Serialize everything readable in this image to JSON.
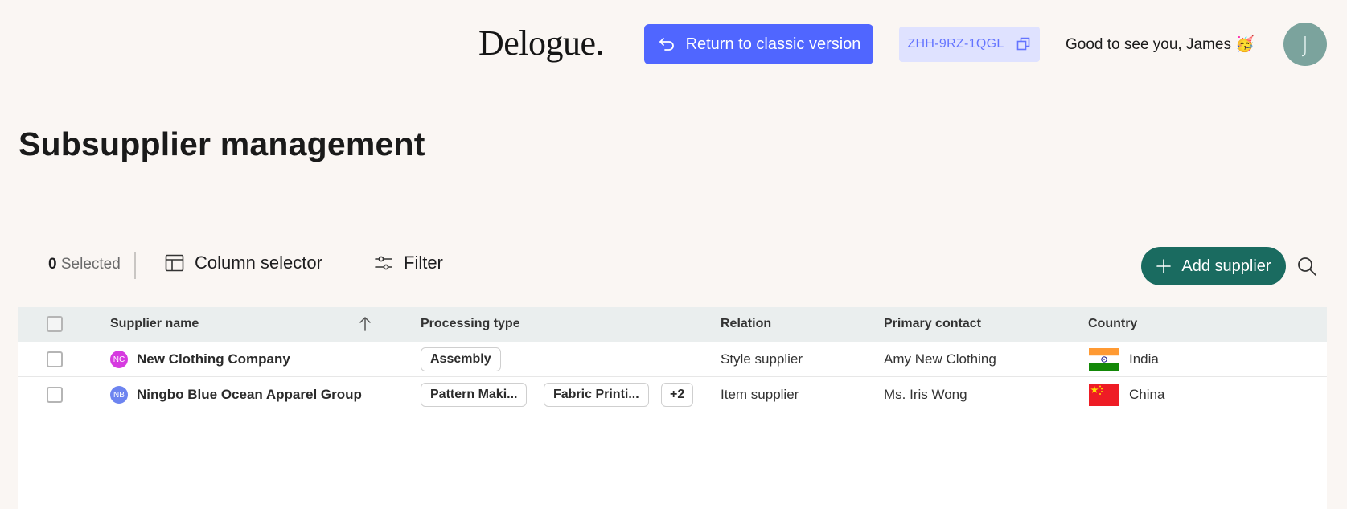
{
  "header": {
    "logo": "Delogue.",
    "classic_button": "Return to classic version",
    "code": "ZHH-9RZ-1QGL",
    "greeting": "Good to see you, James 🥳",
    "avatar_initial": "J"
  },
  "page": {
    "title": "Subsupplier management"
  },
  "toolbar": {
    "selected_count": "0",
    "selected_label": "Selected",
    "column_selector": "Column selector",
    "filter": "Filter",
    "add_supplier": "Add supplier"
  },
  "table": {
    "columns": [
      "Supplier name",
      "Processing type",
      "Relation",
      "Primary contact",
      "Country"
    ],
    "rows": [
      {
        "initials": "NC",
        "initials_color": "#d63be0",
        "name": "New Clothing Company",
        "tags": [
          "Assembly"
        ],
        "relation": "Style supplier",
        "contact": "Amy New Clothing",
        "country": "India"
      },
      {
        "initials": "NB",
        "initials_color": "#6d84f0",
        "name": "Ningbo Blue Ocean Apparel Group",
        "tags": [
          "Pattern Maki...",
          "Fabric Printi...",
          "+2"
        ],
        "relation": "Item supplier",
        "contact": "Ms. Iris Wong",
        "country": "China"
      }
    ]
  },
  "colors": {
    "classic_button": "#5066ff",
    "add_button": "#1a6b60",
    "avatar": "#7ba39d",
    "background": "#faf6f3"
  }
}
